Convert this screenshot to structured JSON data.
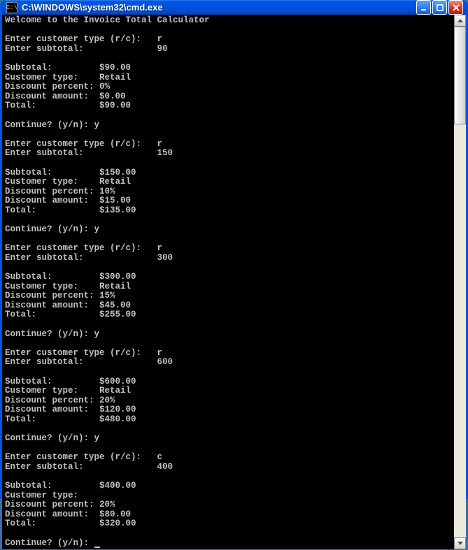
{
  "window": {
    "title": "C:\\WINDOWS\\system32\\cmd.exe",
    "icon_text": "C:\\"
  },
  "terminal": {
    "welcome": "Welcome to the Invoice Total Calculator",
    "sessions": [
      {
        "prompt_type": "Enter customer type (r/c):   r",
        "prompt_sub": "Enter subtotal:              90",
        "lines": [
          "Subtotal:         $90.00",
          "Customer type:    Retail",
          "Discount percent: 0%",
          "Discount amount:  $0.00",
          "Total:            $90.00"
        ],
        "cont": "Continue? (y/n): y"
      },
      {
        "prompt_type": "Enter customer type (r/c):   r",
        "prompt_sub": "Enter subtotal:              150",
        "lines": [
          "Subtotal:         $150.00",
          "Customer type:    Retail",
          "Discount percent: 10%",
          "Discount amount:  $15.00",
          "Total:            $135.00"
        ],
        "cont": "Continue? (y/n): y"
      },
      {
        "prompt_type": "Enter customer type (r/c):   r",
        "prompt_sub": "Enter subtotal:              300",
        "lines": [
          "Subtotal:         $300.00",
          "Customer type:    Retail",
          "Discount percent: 15%",
          "Discount amount:  $45.00",
          "Total:            $255.00"
        ],
        "cont": "Continue? (y/n): y"
      },
      {
        "prompt_type": "Enter customer type (r/c):   r",
        "prompt_sub": "Enter subtotal:              600",
        "lines": [
          "Subtotal:         $600.00",
          "Customer type:    Retail",
          "Discount percent: 20%",
          "Discount amount:  $120.00",
          "Total:            $480.00"
        ],
        "cont": "Continue? (y/n): y"
      },
      {
        "prompt_type": "Enter customer type (r/c):   c",
        "prompt_sub": "Enter subtotal:              400",
        "lines": [
          "Subtotal:         $400.00",
          "Customer type:",
          "Discount percent: 20%",
          "Discount amount:  $80.00",
          "Total:            $320.00"
        ],
        "cont": "Continue? (y/n): "
      }
    ]
  }
}
